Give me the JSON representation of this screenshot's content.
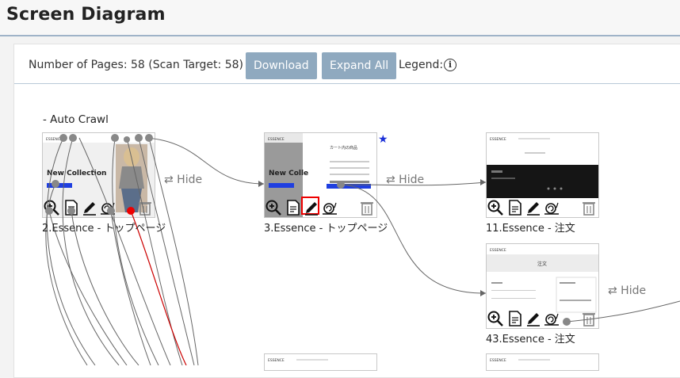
{
  "header": {
    "title": "Screen Diagram"
  },
  "toolbar": {
    "pages_label": "Number of Pages:",
    "pages_value": "58 (Scan Target: 58)",
    "download_label": "Download",
    "expand_label": "Expand All",
    "legend_label": "Legend:",
    "info_glyph": "i"
  },
  "groups": [
    {
      "label": "- Auto Crawl"
    }
  ],
  "nodes": [
    {
      "title": "2.Essence - トップページ",
      "hero_text": "New Collection",
      "hide_label": "⇄ Hide"
    },
    {
      "title": "3.Essence - トップページ",
      "hero_text": "New Colle",
      "cart_heading": "カート内の商品",
      "hide_label": "⇄ Hide",
      "starred": true
    },
    {
      "title": "11.Essence - 注文"
    },
    {
      "title": "43.Essence - 注文",
      "heading": "注文",
      "hide_label": "⇄ Hide"
    }
  ],
  "thumb_brand": "ESSENCE",
  "star_glyph": "★",
  "icons": [
    "zoom-in-icon",
    "document-icon",
    "edit-pencil-icon",
    "snail-icon",
    "trash-icon"
  ],
  "colors": {
    "accent": "#8fa9bf",
    "link": "#777777",
    "highlight": "#e00000",
    "star": "#1a2fd8"
  }
}
